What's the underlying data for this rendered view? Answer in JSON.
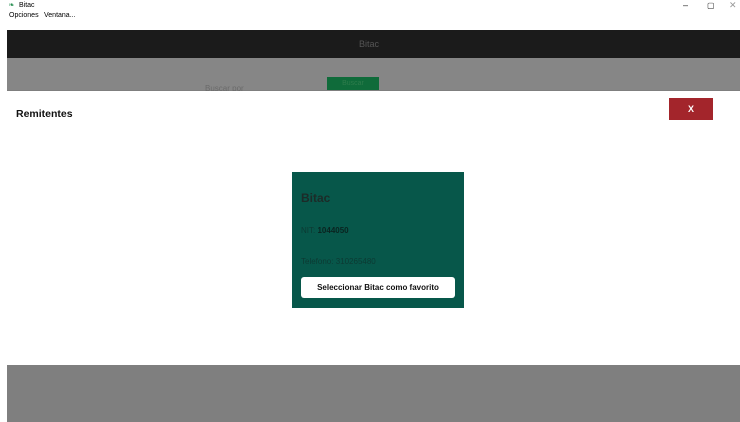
{
  "window": {
    "title": "Bitac",
    "app_icon": "bitac-app-icon",
    "controls": {
      "minimize": "–",
      "maximize": "▢",
      "close": "✕"
    }
  },
  "menubar": {
    "items": [
      "Opciones",
      "Ventana..."
    ]
  },
  "background_app": {
    "header_label": "Bitac",
    "field_label": "Buscar por",
    "button_label": "Buscar"
  },
  "modal": {
    "title": "Remitentes",
    "close_label": "X",
    "sender_card": {
      "name": "Bitac",
      "nit_label": "NIT:",
      "nit_value": "1044050",
      "phone_label": "Telefono:",
      "phone_value": "310265480",
      "favorite_button_label": "Seleccionar Bitac como favorito"
    }
  },
  "colors": {
    "close_button": "#a3252b",
    "card_background": "#07574a",
    "overlay": "#7f7f7f"
  }
}
